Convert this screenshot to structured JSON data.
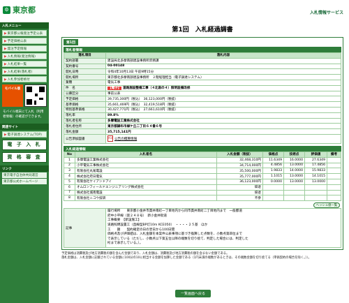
{
  "header": {
    "logo_text": "東京都",
    "service_name": "入札情報サービス"
  },
  "sidebar": {
    "menu_heading": "入札メニュー",
    "items": [
      {
        "label": "東京都公報発注予定公表"
      },
      {
        "label": "予定価格公表"
      },
      {
        "label": "発注予定情報"
      },
      {
        "label": "入札情報(発注情報)"
      },
      {
        "label": "入札結果一覧"
      },
      {
        "label": "入札結果(落札者)"
      },
      {
        "label": "入札参加者格付"
      }
    ],
    "mobile_label": "モバイル版",
    "mobile_note": "モバイル端末にて入札（利用者情報）の確認ができます。",
    "site_heading": "関連サイト",
    "site_link": "電子調達システム(TOP)",
    "big_buttons": [
      {
        "label": "電 子 入 札"
      },
      {
        "label": "資 格 審 査"
      }
    ],
    "links_heading": "リンク",
    "links": [
      {
        "label": "東京電子自治体共同運営"
      },
      {
        "label": "東京都公式ホームページ"
      }
    ]
  },
  "page": {
    "title": "第1回　入札経過調書",
    "tab": "第1回"
  },
  "award": {
    "section": "落札者情報",
    "col_item": "落札項目",
    "col_content": "落札内容",
    "rows": [
      {
        "label": "契約部署",
        "value": "建設局北多摩南部建設事務所庶務課"
      },
      {
        "label": "契約番号",
        "value": "04-00148"
      },
      {
        "label": "開札日時",
        "value": "令和4年10月13日 午前9時15分"
      },
      {
        "label": "開札場所",
        "value": "東京都北多摩南部建設事務所　２階経理担当（電子調達システム）"
      },
      {
        "label": "業種",
        "value": "電気工事"
      },
      {
        "label": "件　名",
        "badge": "【電子】",
        "value": "道路施設整備工事（４北南の４）照明設備改修"
      },
      {
        "label": "公募区分",
        "value": "事前公表"
      },
      {
        "label": "予定価格",
        "value": "39,735,300円（税込）　36,123,000円（税抜）"
      },
      {
        "label": "基準価格",
        "value": "35,661,469円（税込）　32,419,518円（税抜）"
      },
      {
        "label": "特別基準価格",
        "value": "30,427,771円（税込）　27,661,610円（税抜）"
      },
      {
        "label": "落札率",
        "value": "89.8%"
      },
      {
        "label": "落札者名称",
        "value": "多摩電設工業株式会社"
      },
      {
        "label": "落札者住所",
        "value": "東京都調布市緑ケ丘二丁目６４番６号"
      },
      {
        "label": "落札金額",
        "value": "35,715,141円"
      }
    ],
    "disclosure_label": "公告添加図書",
    "disclosure_link": "公告の積算情報"
  },
  "bidders": {
    "section": "入札経過情報",
    "headers": [
      "No",
      "入札者名",
      "入札金額（税抜）",
      "価格点",
      "技術点",
      "評価値",
      "備考"
    ],
    "rows": [
      {
        "no": "1",
        "name": "多摩電設工業株式会社",
        "amount": "32,468,310円",
        "price": "11.6349",
        "tech": "16.0000",
        "eval": "27.6349",
        "note": ""
      },
      {
        "no": "2",
        "name": "小平電気工事株式会社",
        "amount": "34,714,000円",
        "price": "4.4856",
        "tech": "13.0000",
        "eval": "17.4856",
        "note": ""
      },
      {
        "no": "3",
        "name": "有限会社丸尾電設",
        "amount": "35,500,000円",
        "price": "1.9833",
        "tech": "14.0000",
        "eval": "15.9833",
        "note": ""
      },
      {
        "no": "4",
        "name": "株式会社府日電気",
        "amount": "35,777,000円",
        "price": "1.1015",
        "tech": "13.0000",
        "eval": "14.1015",
        "note": ""
      },
      {
        "no": "5",
        "name": "有限会社ケイアンドアイ",
        "amount": "36,123,000円",
        "price": "0.0000",
        "tech": "13.0000",
        "eval": "13.0000",
        "note": ""
      },
      {
        "no": "6",
        "name": "オムロンフィールドエンジニアリング株式会社",
        "amount": "辞退",
        "price": "",
        "tech": "",
        "eval": "",
        "note": ""
      },
      {
        "no": "7",
        "name": "株式会社城南電設",
        "amount": "辞退",
        "price": "",
        "tech": "",
        "eval": "",
        "note": ""
      },
      {
        "no": "8",
        "name": "有限会社ニコウ技研",
        "amount": "不参",
        "price": "",
        "tech": "",
        "eval": "",
        "note": ""
      }
    ],
    "history_button": "ヘッシュ値一覧"
  },
  "remarks": {
    "label": "記事",
    "lines": [
      "履行場所　　東京都小金井市貫井南町一丁目地内から同市貫井南町二丁目地内まで　一般都道",
      "府中小平線（第２４８号）　新小金井街道",
      "工事概要　【新設施工】",
      "道路照明設置工（直線型BP灯10m KCE050）　・・・・２５基　ほか",
      "工　　期　　契約確定の日の翌日から100日間",
      "価格点及び評価値は、入札金額を本案件公表事項に基づき換算した点数を、小数点第四位まで",
      "で表示している（ただし、小数点以下第五位以降の端数を切り捨て、判定した場合には、判定した",
      "桁まで表示している。）。"
    ]
  },
  "footnotes": [
    "予定価格は消費税及び地方消費税の額を含んだ金額であり、入札金額は、消費税及び地方消費税の額を含まない金額である。",
    "落札金額は、入札金額に記載されている金額に100分の10に相当する金額を加算した金額である（1円未満の端数があるときは、その端数金額を切り捨てる（単価契約の場合を除く。））。"
  ],
  "back_button": "一覧画面へ戻る"
}
